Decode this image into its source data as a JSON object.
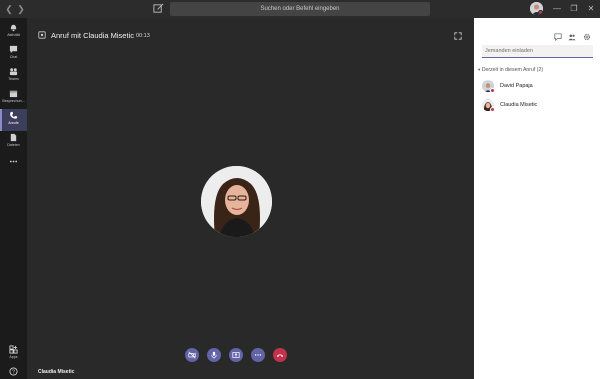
{
  "titlebar": {
    "search_placeholder": "Suchen oder Befehl eingeben"
  },
  "rail": {
    "items": [
      {
        "label": "Aktivität",
        "icon": "bell-icon"
      },
      {
        "label": "Chat",
        "icon": "chat-icon"
      },
      {
        "label": "Teams",
        "icon": "teams-icon"
      },
      {
        "label": "Besprechun...",
        "icon": "calendar-icon"
      },
      {
        "label": "Anrufe",
        "icon": "phone-icon",
        "active": true
      },
      {
        "label": "Dateien",
        "icon": "file-icon"
      },
      {
        "label": "Apps",
        "icon": "apps-icon"
      }
    ]
  },
  "call": {
    "title": "Anruf mit Claudia Misetic",
    "duration": "00:13",
    "caller_name": "Claudia Misetic"
  },
  "controls": [
    {
      "name": "video-off-button",
      "icon": "video-off-icon"
    },
    {
      "name": "mic-button",
      "icon": "microphone-icon"
    },
    {
      "name": "share-button",
      "icon": "share-screen-icon"
    },
    {
      "name": "more-button",
      "icon": "more-icon"
    },
    {
      "name": "hangup-button",
      "icon": "hangup-icon"
    }
  ],
  "panel": {
    "invite_placeholder": "Jemanden einladen",
    "section_label": "Derzeit in diesem Anruf (2)",
    "participants": [
      {
        "name": "David Papaja"
      },
      {
        "name": "Claudia Misetic"
      }
    ]
  },
  "colors": {
    "accent": "#6264a7",
    "hangup": "#c4314b",
    "stage": "#292929",
    "rail": "#1b1b1b"
  }
}
